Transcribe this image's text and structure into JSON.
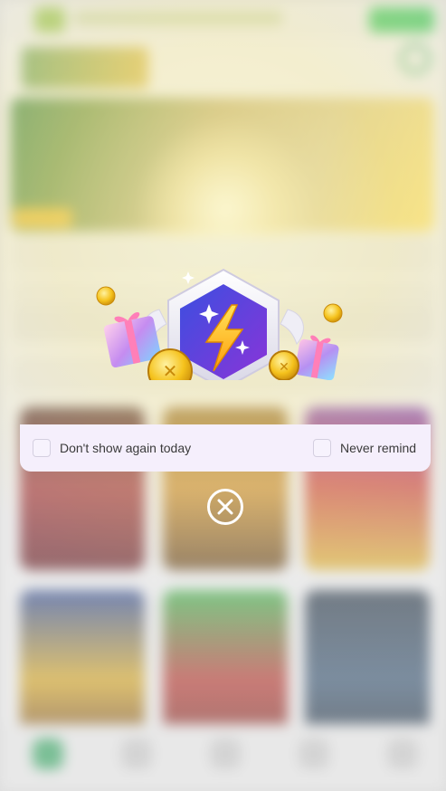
{
  "popup": {
    "option_today": "Don't show again today",
    "option_never": "Never remind",
    "close_icon": "close-x-circle-icon",
    "art_icon": "lightning-shield-icon"
  },
  "background": {
    "download_label": "",
    "state": "blurred"
  },
  "colors": {
    "options_bar_bg": "#f5effc",
    "badge_purple": "#5b3be0",
    "bolt_yellow": "#ffc21a",
    "background_green": "#22c24a"
  }
}
